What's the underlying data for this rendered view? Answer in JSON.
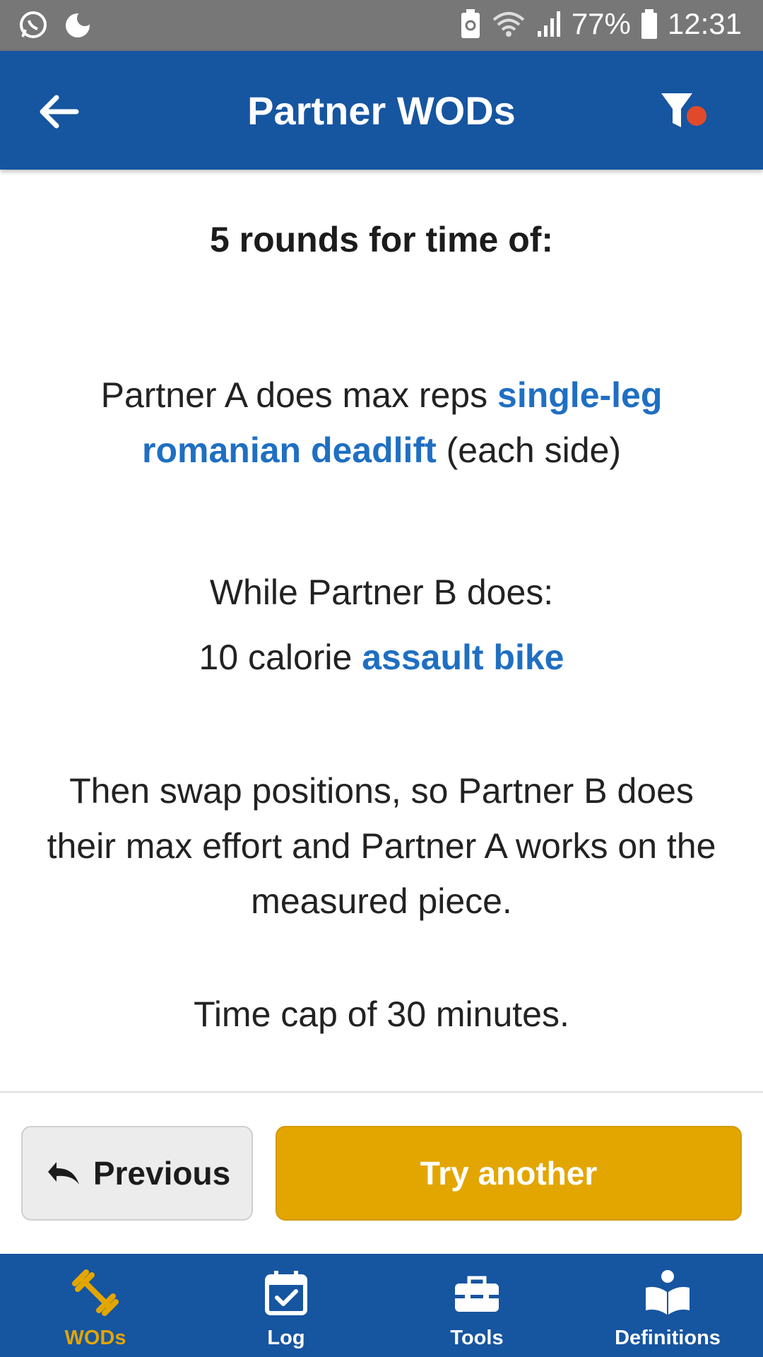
{
  "status_bar": {
    "battery": "77%",
    "time": "12:31",
    "icons": [
      "whatsapp-icon",
      "moon-icon",
      "battery-saver-icon",
      "wifi-icon",
      "signal-icon",
      "battery-icon"
    ]
  },
  "appbar": {
    "title": "Partner WODs",
    "back_icon": "arrow-left-icon",
    "filter_icon": "filter-icon",
    "filter_badge_color": "#e04a2a"
  },
  "workout": {
    "heading": "5 rounds for time of:",
    "p1_text_before": "Partner A does max reps ",
    "p1_link": "single-leg romanian deadlift",
    "p1_text_after": " (each side)",
    "p2_line1": "While Partner B does:",
    "p2_text_before": "10 calorie ",
    "p2_link": "assault bike",
    "p3": "Then swap positions, so Partner B does their max effort and Partner A works on the measured piece.",
    "p4": "Time cap of 30 minutes."
  },
  "buttons": {
    "previous_label": "Previous",
    "try_another_label": "Try another"
  },
  "bottom_nav": {
    "items": [
      {
        "label": "WODs",
        "icon": "dumbbell-icon",
        "active": true
      },
      {
        "label": "Log",
        "icon": "calendar-check-icon",
        "active": false
      },
      {
        "label": "Tools",
        "icon": "toolbox-icon",
        "active": false
      },
      {
        "label": "Definitions",
        "icon": "book-reader-icon",
        "active": false
      }
    ]
  },
  "colors": {
    "primary": "#1655a0",
    "accent": "#e3a600",
    "link": "#1f6fc2",
    "status_bar": "#777777"
  }
}
